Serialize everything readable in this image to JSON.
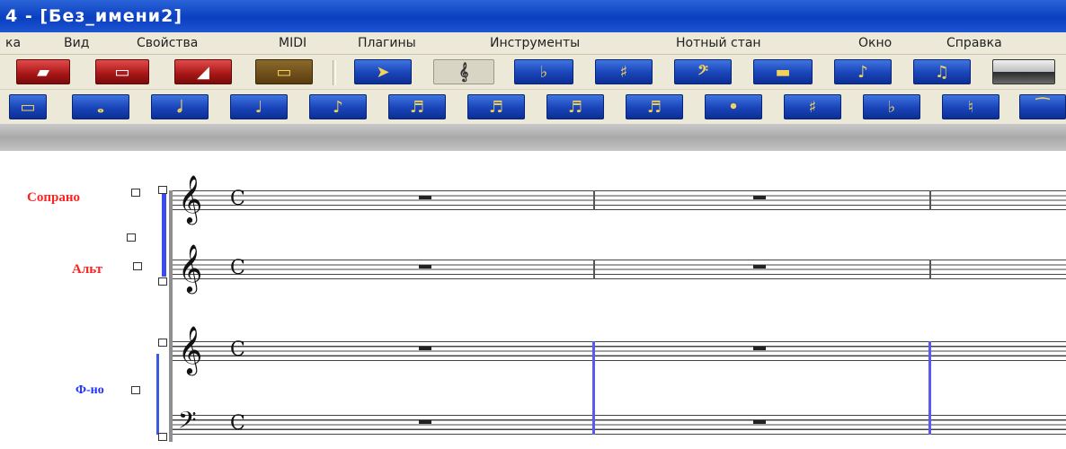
{
  "window": {
    "title": "4 - [Без_имени2]"
  },
  "menu": {
    "items": [
      "ка",
      "Вид",
      "Свойства",
      "MIDI",
      "Плагины",
      "Инструменты",
      "Нотный стан",
      "Окно",
      "Справка"
    ]
  },
  "toolbar1": {
    "buttons": [
      "save-icon",
      "print-icon",
      "midi-record-icon",
      "playback-icon",
      "selection-arrow-icon",
      "staff-clef-icon",
      "key-signature-icon",
      "time-signature-icon",
      "bass-clef-icon",
      "measure-icon",
      "note-entry-icon",
      "chord-icon",
      "keyboard-icon"
    ]
  },
  "toolbar2": {
    "buttons": [
      "breve-icon",
      "whole-note-icon",
      "half-note-icon",
      "quarter-note-icon",
      "eighth-note-icon",
      "sixteenth-note-icon",
      "thirty-second-note-icon",
      "sixty-fourth-note-icon",
      "hundred-twenty-eighth-note-icon",
      "dot-icon",
      "sharp-icon",
      "flat-icon",
      "natural-icon",
      "tie-icon"
    ]
  },
  "score": {
    "staves": [
      {
        "label": "Сопрано",
        "color": "#ff2020",
        "clef": "treble",
        "time_signature": "C"
      },
      {
        "label": "Альт",
        "color": "#ff2020",
        "clef": "treble",
        "time_signature": "C"
      },
      {
        "label": "Ф-но",
        "color": "#2030ff",
        "clef": "treble",
        "time_signature": "C"
      },
      {
        "label": "",
        "clef": "bass",
        "time_signature": "C"
      }
    ],
    "rest_type": "whole-rest"
  },
  "colors": {
    "titlebar": "#0a3fc0",
    "menu_bg": "#ece9d8",
    "vocal_label": "#ff2020",
    "piano_label": "#2030ff",
    "piano_barline": "#5a5aee"
  }
}
